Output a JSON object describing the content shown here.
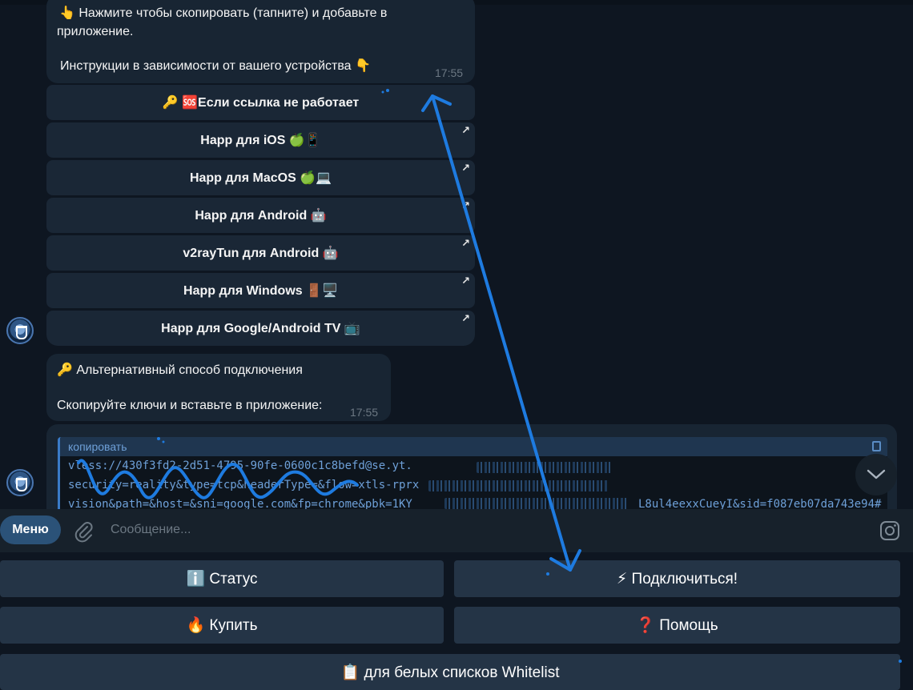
{
  "messages": {
    "first": {
      "line1": "👆 Нажмите чтобы скопировать (тапните) и добавьте в",
      "line2": "приложение.",
      "line3": "Инструкции в зависимости от вашего устройства 👇",
      "time": "17:55"
    },
    "keyboard": [
      {
        "label": "🔑 🆘Если ссылка не работает",
        "link": false
      },
      {
        "label": "Happ для iOS 🍏📱",
        "link": true
      },
      {
        "label": "Happ для MacOS 🍏💻",
        "link": true
      },
      {
        "label": "Happ для Android 🤖",
        "link": true
      },
      {
        "label": "v2rayTun для Android 🤖",
        "link": true
      },
      {
        "label": "Happ для Windows 🚪🖥️",
        "link": true
      },
      {
        "label": "Happ для Google/Android TV 📺",
        "link": true
      }
    ],
    "second": {
      "line1": "🔑 Альтернативный способ подключения",
      "line2": "Скопируйте ключи и вставьте в приложение:",
      "time": "17:55"
    },
    "code": {
      "header": "копировать",
      "lines": [
        "vless://430f3fd2-2d51-4795-90fe-0600c1c8befd@se.yt.",
        "security=reality&type=tcp&headerType=&flow=xtls-rprx",
        "vision&path=&host=&sni=google.com&fp=chrome&pbk=1KY_",
        "L8ul4eexxCueyI&sid=f087eb07da743e94#"
      ]
    }
  },
  "icons": {
    "link_arrow": "↗",
    "scroll_down": "chevron-down-icon",
    "attach": "paperclip-icon",
    "sticker": "sticker-icon"
  },
  "input": {
    "menu_label": "Меню",
    "placeholder": "Сообщение..."
  },
  "reply_keyboard": {
    "status": "ℹ️ Статус",
    "connect": "⚡ Подключиться!",
    "buy": "🔥 Купить",
    "help": "❓ Помощь",
    "whitelist": "📋 для белых списков Whitelist"
  },
  "colors": {
    "background": "#0e1621",
    "bubble": "#182533",
    "accent": "#2b5278",
    "annotation": "#1e7be0",
    "code_text": "#6ea0d8"
  }
}
